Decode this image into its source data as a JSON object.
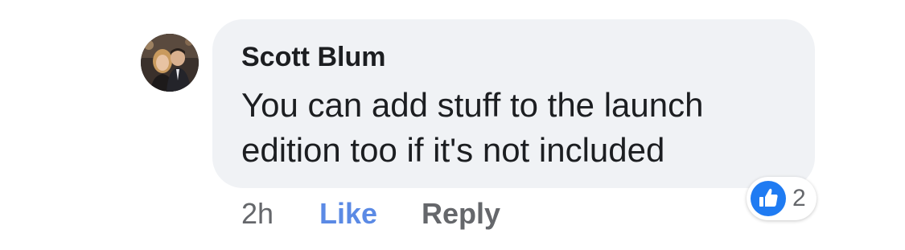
{
  "comment": {
    "author": "Scott Blum",
    "text": "You can add stuff to the launch edition too if it's not included",
    "timestamp": "2h",
    "like_label": "Like",
    "reply_label": "Reply",
    "reaction": {
      "icon": "like-icon",
      "count": "2",
      "color": "#1f7bf2"
    }
  },
  "colors": {
    "bubble": "#f0f2f5",
    "text": "#1c1e21",
    "secondary": "#65676b",
    "like_link": "#5b8ae5"
  }
}
